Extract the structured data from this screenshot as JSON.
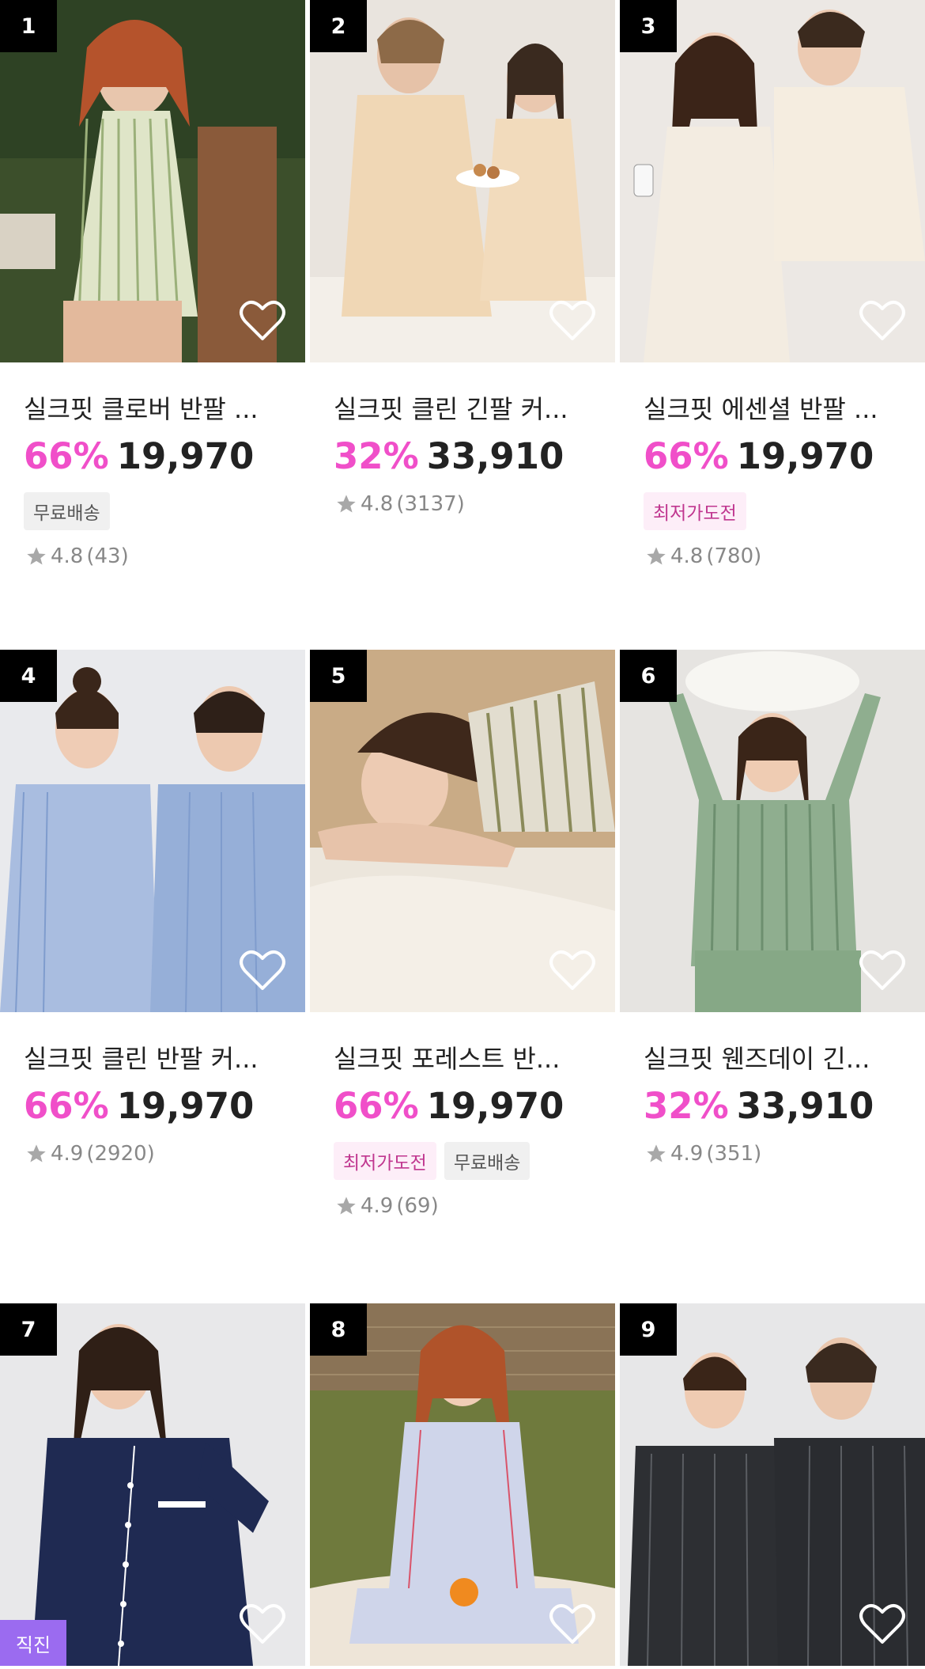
{
  "products": [
    {
      "rank": "1",
      "title": "실크핏 클로버 반팔 ...",
      "discount": "66%",
      "price": "19,970",
      "badges": [
        "무료배송"
      ],
      "rating": "4.8",
      "reviews": "(43)",
      "photo": "green-striped-pajama"
    },
    {
      "rank": "2",
      "title": "실크핏 클린 긴팔 커...",
      "discount": "32%",
      "price": "33,910",
      "badges": [],
      "rating": "4.8",
      "reviews": "(3137)",
      "photo": "beige-couple-pajama"
    },
    {
      "rank": "3",
      "title": "실크핏 에센셜 반팔 ...",
      "discount": "66%",
      "price": "19,970",
      "badges": [
        "최저가도전"
      ],
      "rating": "4.8",
      "reviews": "(780)",
      "photo": "cream-couple-pajama"
    },
    {
      "rank": "4",
      "title": "실크핏 클린 반팔 커...",
      "discount": "66%",
      "price": "19,970",
      "badges": [],
      "rating": "4.9",
      "reviews": "(2920)",
      "photo": "blue-couple-pajama"
    },
    {
      "rank": "5",
      "title": "실크핏 포레스트 반...",
      "discount": "66%",
      "price": "19,970",
      "badges": [
        "최저가도전",
        "무료배송"
      ],
      "rating": "4.9",
      "reviews": "(69)",
      "photo": "olive-striped-pajama"
    },
    {
      "rank": "6",
      "title": "실크핏 웬즈데이 긴...",
      "discount": "32%",
      "price": "33,910",
      "badges": [],
      "rating": "4.9",
      "reviews": "(351)",
      "photo": "mint-striped-pajama"
    },
    {
      "rank": "7",
      "title": "",
      "discount": "",
      "price": "",
      "badges": [],
      "rating": "",
      "reviews": "",
      "direct_label": "직진",
      "photo": "navy-pajama"
    },
    {
      "rank": "8",
      "title": "",
      "discount": "",
      "price": "",
      "badges": [],
      "rating": "",
      "reviews": "",
      "photo": "sky-striped-pajama"
    },
    {
      "rank": "9",
      "title": "",
      "discount": "",
      "price": "",
      "badges": [],
      "rating": "",
      "reviews": "",
      "photo": "charcoal-couple-pajama"
    }
  ],
  "colors": {
    "accent_pink": "#f04fc9",
    "rank_bg": "#000000",
    "direct_badge": "#9b6bf0"
  },
  "icons": [
    "heart-outline-icon",
    "star-icon"
  ]
}
